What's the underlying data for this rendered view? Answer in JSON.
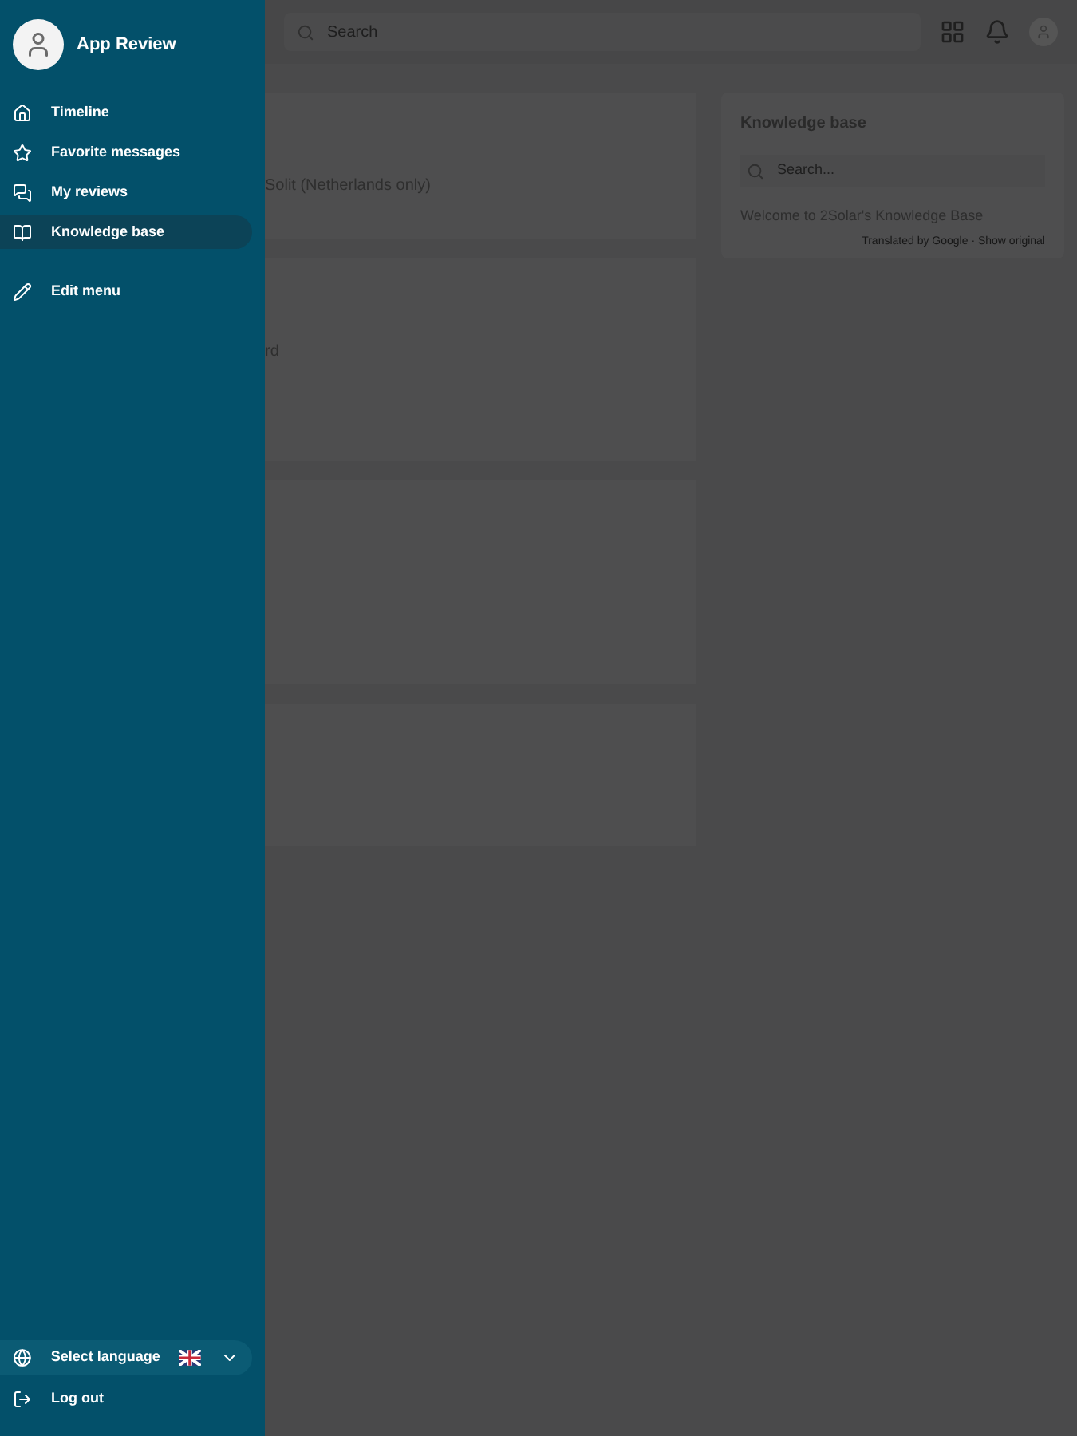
{
  "drawer": {
    "account_name": "App Review",
    "menu": [
      {
        "label": "Timeline",
        "kind": "home",
        "selected": false
      },
      {
        "label": "Favorite messages",
        "kind": "star",
        "selected": false
      },
      {
        "label": "My reviews",
        "kind": "reviews",
        "selected": false
      },
      {
        "label": "Knowledge base",
        "kind": "book",
        "selected": true
      }
    ],
    "edit_menu": "Edit menu",
    "language": {
      "label": "Select language"
    },
    "logout": "Log out"
  },
  "topbar": {
    "search": {
      "placeholder": "Search"
    }
  },
  "feed": {
    "cards": [
      {
        "kind": "text",
        "text": "Solit (Netherlands only)"
      },
      {
        "kind": "text",
        "text": "rd"
      },
      {
        "kind": "blank"
      },
      {
        "kind": "blank"
      }
    ]
  },
  "knowledge_base": {
    "title": "Knowledge base",
    "search": {
      "placeholder": "Search..."
    },
    "welcome": "Welcome to 2Solar's Knowledge Base",
    "translation_note": "Translated by Google · Show original"
  }
}
